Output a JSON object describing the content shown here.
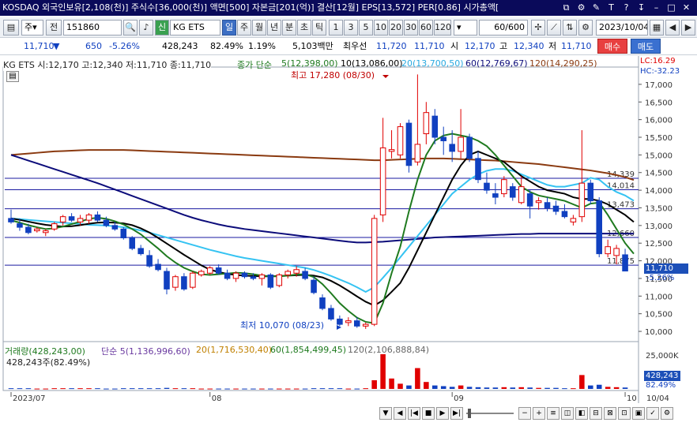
{
  "info_bar": {
    "market": "KOSDAQ",
    "foreign_holdings": "외국인보유[2,108(천)]",
    "shares": "주식수[36,000(천)]",
    "face_value": "액면[500]",
    "capital": "자본금[201(억)]",
    "settlement": "결산[12월]",
    "eps": "EPS[13,572]",
    "per": "PER[0.86]",
    "market_cap": "시가총액["
  },
  "toolbar": {
    "period_label": "주",
    "prev_label": "전",
    "code": "151860",
    "stock_name": "KG ETS",
    "sin_label": "신",
    "tabs": [
      "일",
      "주",
      "월",
      "년",
      "분",
      "초",
      "틱"
    ],
    "active_tab": "일",
    "intervals": [
      "1",
      "3",
      "5",
      "10",
      "20",
      "30",
      "60",
      "120"
    ],
    "count": "60/600",
    "date": "2023/10/04"
  },
  "quote": {
    "price": "11,710",
    "change": "650",
    "change_pct": "-5.26%",
    "volume": "428,243",
    "turnover_rate": "82.49%",
    "ratio": "1.19%",
    "amount": "5,103백만",
    "best_ask_label": "최우선",
    "best_ask": "11,720",
    "best_bid": "11,710",
    "open_label": "시",
    "open": "12,170",
    "high_label": "고",
    "high": "12,340",
    "low_label": "저",
    "low": "11,710",
    "buy_label": "매수",
    "sell_label": "매도"
  },
  "legend": {
    "title": "KG ETS 시:12,170 고:12,340 저:11,710 종:11,710",
    "ma_label": "종가 단순",
    "ma5": "5(12,398,00)",
    "ma10": "10(13,086,00)",
    "ma20": "20(13,700,50)",
    "ma60": "60(12,769,67)",
    "ma120": "120(14,290,25)",
    "lc": "LC:16.29",
    "hc": "HC:-32.23",
    "high_note": "최고 17,280 (08/30)",
    "low_note": "최저 10,070 (08/23)",
    "colors": {
      "ma5": "#1f7a1f",
      "ma10": "#000000",
      "ma20": "#35c3f2",
      "ma60": "#0c0c7a",
      "ma120": "#8a3a10",
      "up": "#e00000",
      "down": "#1040c0"
    }
  },
  "price_axis": {
    "ticks": [
      "17,000",
      "16,500",
      "16,000",
      "15,500",
      "15,000",
      "14,500",
      "14,000",
      "13,500",
      "13,000",
      "12,500",
      "12,000",
      "11,500",
      "11,000",
      "10,500",
      "10,000"
    ],
    "current_price": "11,710",
    "current_change": "-5.26%"
  },
  "levels": [
    {
      "label": "14,339",
      "value": 14339
    },
    {
      "label": "14,014",
      "value": 14014
    },
    {
      "label": "13,473",
      "value": 13473
    },
    {
      "label": "12,660",
      "value": 12660
    },
    {
      "label": "11,875",
      "value": 11875
    }
  ],
  "volume_legend": {
    "title": "거래량(428,243,00)",
    "ma5": "단순 5(1,136,996,60)",
    "ma20": "20(1,716,530,40)",
    "ma60": "60(1,854,499,45)",
    "ma120": "120(2,106,888,84)",
    "current": "428,243주(82.49%)",
    "axis_top": "25,000K",
    "axis_val": "428,243",
    "axis_pct": "82.49%"
  },
  "date_axis": {
    "labels": [
      "2023/07",
      "08",
      "09",
      "10"
    ],
    "last": "10/04"
  },
  "chart_data": {
    "type": "candlestick",
    "ylim": [
      9800,
      17400
    ],
    "candles": [
      {
        "o": 13200,
        "h": 13450,
        "l": 13050,
        "c": 13100
      },
      {
        "o": 13050,
        "h": 13200,
        "l": 12850,
        "c": 12950
      },
      {
        "o": 12950,
        "h": 13050,
        "l": 12750,
        "c": 12800
      },
      {
        "o": 12850,
        "h": 12950,
        "l": 12800,
        "c": 12900
      },
      {
        "o": 12800,
        "h": 12900,
        "l": 12700,
        "c": 12850
      },
      {
        "o": 12900,
        "h": 13100,
        "l": 12850,
        "c": 13050
      },
      {
        "o": 13100,
        "h": 13300,
        "l": 13000,
        "c": 13250
      },
      {
        "o": 13250,
        "h": 13350,
        "l": 13100,
        "c": 13150
      },
      {
        "o": 13100,
        "h": 13300,
        "l": 13000,
        "c": 13200
      },
      {
        "o": 13150,
        "h": 13350,
        "l": 13050,
        "c": 13300
      },
      {
        "o": 13300,
        "h": 13400,
        "l": 13100,
        "c": 13150
      },
      {
        "o": 13150,
        "h": 13250,
        "l": 12950,
        "c": 13000
      },
      {
        "o": 13000,
        "h": 13100,
        "l": 12850,
        "c": 12900
      },
      {
        "o": 12900,
        "h": 12950,
        "l": 12600,
        "c": 12650
      },
      {
        "o": 12650,
        "h": 12700,
        "l": 12300,
        "c": 12350
      },
      {
        "o": 12350,
        "h": 12450,
        "l": 12150,
        "c": 12200
      },
      {
        "o": 12150,
        "h": 12300,
        "l": 11800,
        "c": 11850
      },
      {
        "o": 11900,
        "h": 12050,
        "l": 11700,
        "c": 11750
      },
      {
        "o": 11700,
        "h": 11800,
        "l": 11050,
        "c": 11200
      },
      {
        "o": 11250,
        "h": 11600,
        "l": 11150,
        "c": 11550
      },
      {
        "o": 11550,
        "h": 11650,
        "l": 11150,
        "c": 11200
      },
      {
        "o": 11250,
        "h": 11700,
        "l": 11200,
        "c": 11650
      },
      {
        "o": 11600,
        "h": 11750,
        "l": 11550,
        "c": 11700
      },
      {
        "o": 11650,
        "h": 11850,
        "l": 11600,
        "c": 11800
      },
      {
        "o": 11800,
        "h": 11900,
        "l": 11600,
        "c": 11650
      },
      {
        "o": 11650,
        "h": 11750,
        "l": 11450,
        "c": 11500
      },
      {
        "o": 11500,
        "h": 11700,
        "l": 11400,
        "c": 11650
      },
      {
        "o": 11650,
        "h": 11700,
        "l": 11500,
        "c": 11550
      },
      {
        "o": 11550,
        "h": 11650,
        "l": 11450,
        "c": 11500
      },
      {
        "o": 11500,
        "h": 11650,
        "l": 11300,
        "c": 11600
      },
      {
        "o": 11600,
        "h": 11650,
        "l": 11200,
        "c": 11250
      },
      {
        "o": 11300,
        "h": 11650,
        "l": 11250,
        "c": 11600
      },
      {
        "o": 11600,
        "h": 11750,
        "l": 11500,
        "c": 11700
      },
      {
        "o": 11650,
        "h": 11850,
        "l": 11550,
        "c": 11750
      },
      {
        "o": 11700,
        "h": 11800,
        "l": 11450,
        "c": 11500
      },
      {
        "o": 11450,
        "h": 11550,
        "l": 11050,
        "c": 11100
      },
      {
        "o": 10950,
        "h": 11050,
        "l": 10600,
        "c": 10650
      },
      {
        "o": 10650,
        "h": 10750,
        "l": 10300,
        "c": 10350
      },
      {
        "o": 10350,
        "h": 10450,
        "l": 10150,
        "c": 10200
      },
      {
        "o": 10250,
        "h": 10400,
        "l": 10150,
        "c": 10300
      },
      {
        "o": 10300,
        "h": 10400,
        "l": 10100,
        "c": 10150
      },
      {
        "o": 10150,
        "h": 10250,
        "l": 10070,
        "c": 10200
      },
      {
        "o": 10200,
        "h": 13300,
        "l": 10150,
        "c": 13200
      },
      {
        "o": 13300,
        "h": 16050,
        "l": 13100,
        "c": 15200
      },
      {
        "o": 15100,
        "h": 15700,
        "l": 14900,
        "c": 15150
      },
      {
        "o": 15000,
        "h": 15900,
        "l": 14900,
        "c": 15800
      },
      {
        "o": 15900,
        "h": 16000,
        "l": 14500,
        "c": 14700
      },
      {
        "o": 14800,
        "h": 17280,
        "l": 14700,
        "c": 15300
      },
      {
        "o": 15600,
        "h": 16500,
        "l": 15300,
        "c": 16200
      },
      {
        "o": 16100,
        "h": 16300,
        "l": 15300,
        "c": 15500
      },
      {
        "o": 15500,
        "h": 15800,
        "l": 15000,
        "c": 15400
      },
      {
        "o": 15300,
        "h": 15700,
        "l": 14800,
        "c": 15100
      },
      {
        "o": 15100,
        "h": 16300,
        "l": 14900,
        "c": 15500
      },
      {
        "o": 15500,
        "h": 15600,
        "l": 14800,
        "c": 14900
      },
      {
        "o": 14900,
        "h": 15100,
        "l": 14200,
        "c": 14300
      },
      {
        "o": 14200,
        "h": 14500,
        "l": 13900,
        "c": 14000
      },
      {
        "o": 13900,
        "h": 14200,
        "l": 13600,
        "c": 13800
      },
      {
        "o": 13900,
        "h": 14400,
        "l": 13800,
        "c": 14300
      },
      {
        "o": 14100,
        "h": 14200,
        "l": 13700,
        "c": 13800
      },
      {
        "o": 13650,
        "h": 14400,
        "l": 13600,
        "c": 14100
      },
      {
        "o": 13900,
        "h": 14000,
        "l": 13200,
        "c": 13550
      },
      {
        "o": 13650,
        "h": 13800,
        "l": 13450,
        "c": 13700
      },
      {
        "o": 13650,
        "h": 13800,
        "l": 13400,
        "c": 13500
      },
      {
        "o": 13550,
        "h": 13700,
        "l": 13300,
        "c": 13400
      },
      {
        "o": 13400,
        "h": 13600,
        "l": 13200,
        "c": 13250
      },
      {
        "o": 13100,
        "h": 13300,
        "l": 13000,
        "c": 13200
      },
      {
        "o": 13250,
        "h": 15700,
        "l": 13100,
        "c": 14200
      },
      {
        "o": 14200,
        "h": 14300,
        "l": 13600,
        "c": 13700
      },
      {
        "o": 13700,
        "h": 13800,
        "l": 12100,
        "c": 12200
      },
      {
        "o": 12200,
        "h": 12600,
        "l": 12100,
        "c": 12400
      },
      {
        "o": 12150,
        "h": 12450,
        "l": 11900,
        "c": 12350
      },
      {
        "o": 12170,
        "h": 12340,
        "l": 11710,
        "c": 11710
      }
    ],
    "ma5": [
      13150,
      13080,
      13010,
      12950,
      12900,
      12920,
      12970,
      13040,
      13110,
      13190,
      13220,
      13190,
      13120,
      13030,
      12900,
      12750,
      12550,
      12350,
      12130,
      11950,
      11800,
      11700,
      11620,
      11600,
      11620,
      11640,
      11660,
      11650,
      11620,
      11580,
      11560,
      11560,
      11580,
      11610,
      11620,
      11540,
      11340,
      11080,
      10800,
      10580,
      10390,
      10270,
      10230,
      10800,
      11650,
      12400,
      13400,
      14300,
      15000,
      15400,
      15550,
      15600,
      15550,
      15500,
      15400,
      15250,
      15000,
      14700,
      14400,
      14100,
      13950,
      13850,
      13800,
      13750,
      13700,
      13600,
      13500,
      13620,
      13650,
      13300,
      12900,
      12500,
      12200
    ],
    "ma10": [
      13200,
      13160,
      13110,
      13060,
      13020,
      12990,
      12970,
      12980,
      13010,
      13050,
      13080,
      13090,
      13080,
      13060,
      13010,
      12920,
      12800,
      12650,
      12490,
      12330,
      12170,
      12020,
      11870,
      11750,
      11680,
      11630,
      11600,
      11580,
      11570,
      11560,
      11560,
      11570,
      11580,
      11590,
      11600,
      11580,
      11530,
      11430,
      11300,
      11150,
      10990,
      10840,
      10730,
      10880,
      11120,
      11370,
      11800,
      12300,
      12800,
      13300,
      13800,
      14300,
      14700,
      15000,
      15100,
      15000,
      14900,
      14800,
      14600,
      14400,
      14250,
      14100,
      14000,
      13950,
      13900,
      13800,
      13750,
      13750,
      13700,
      13600,
      13450,
      13300,
      13100
    ],
    "ma20": [
      13200,
      13180,
      13160,
      13140,
      13120,
      13100,
      13080,
      13060,
      13040,
      13020,
      13010,
      13000,
      12980,
      12950,
      12910,
      12860,
      12800,
      12730,
      12660,
      12590,
      12520,
      12450,
      12380,
      12310,
      12250,
      12190,
      12130,
      12080,
      12040,
      12000,
      11960,
      11920,
      11880,
      11840,
      11800,
      11740,
      11660,
      11570,
      11470,
      11370,
      11250,
      11120,
      11250,
      11520,
      11800,
      12100,
      12400,
      12700,
      13000,
      13300,
      13600,
      13900,
      14100,
      14300,
      14450,
      14550,
      14600,
      14600,
      14550,
      14450,
      14350,
      14250,
      14150,
      14100,
      14100,
      14150,
      14200,
      14350,
      14300,
      14100,
      13950,
      13850,
      13700
    ],
    "ma60": [
      15000,
      14920,
      14840,
      14760,
      14680,
      14600,
      14520,
      14440,
      14360,
      14280,
      14200,
      14110,
      14020,
      13930,
      13840,
      13750,
      13660,
      13570,
      13480,
      13390,
      13300,
      13220,
      13150,
      13090,
      13030,
      12980,
      12940,
      12900,
      12870,
      12840,
      12810,
      12780,
      12750,
      12720,
      12690,
      12660,
      12630,
      12600,
      12570,
      12540,
      12520,
      12520,
      12530,
      12540,
      12560,
      12580,
      12600,
      12620,
      12640,
      12660,
      12670,
      12680,
      12690,
      12700,
      12710,
      12720,
      12730,
      12740,
      12750,
      12760,
      12760,
      12770,
      12770,
      12770,
      12770,
      12770,
      12770,
      12770,
      12770,
      12770,
      12770,
      12770,
      12770
    ],
    "ma120": [
      15000,
      15020,
      15040,
      15060,
      15080,
      15100,
      15110,
      15120,
      15130,
      15140,
      15140,
      15140,
      15140,
      15140,
      15130,
      15120,
      15110,
      15100,
      15090,
      15080,
      15070,
      15060,
      15050,
      15040,
      15030,
      15020,
      15010,
      15000,
      14990,
      14980,
      14970,
      14960,
      14950,
      14940,
      14930,
      14920,
      14910,
      14900,
      14890,
      14880,
      14870,
      14860,
      14850,
      14850,
      14860,
      14870,
      14880,
      14890,
      14900,
      14900,
      14900,
      14890,
      14880,
      14870,
      14860,
      14850,
      14840,
      14820,
      14800,
      14780,
      14760,
      14740,
      14710,
      14680,
      14650,
      14620,
      14590,
      14560,
      14520,
      14480,
      14430,
      14370,
      14290
    ],
    "volume": [
      0.02,
      0.02,
      0.02,
      0.01,
      0.01,
      0.02,
      0.02,
      0.02,
      0.02,
      0.02,
      0.02,
      0.01,
      0.01,
      0.02,
      0.02,
      0.02,
      0.02,
      0.02,
      0.03,
      0.02,
      0.02,
      0.02,
      0.01,
      0.01,
      0.01,
      0.01,
      0.01,
      0.01,
      0.01,
      0.01,
      0.01,
      0.01,
      0.01,
      0.01,
      0.01,
      0.02,
      0.02,
      0.02,
      0.02,
      0.01,
      0.01,
      0.02,
      0.25,
      1.0,
      0.3,
      0.15,
      0.1,
      0.6,
      0.2,
      0.1,
      0.08,
      0.06,
      0.1,
      0.06,
      0.05,
      0.04,
      0.04,
      0.05,
      0.04,
      0.05,
      0.04,
      0.03,
      0.03,
      0.03,
      0.02,
      0.02,
      0.4,
      0.1,
      0.12,
      0.06,
      0.05,
      0.04
    ]
  }
}
